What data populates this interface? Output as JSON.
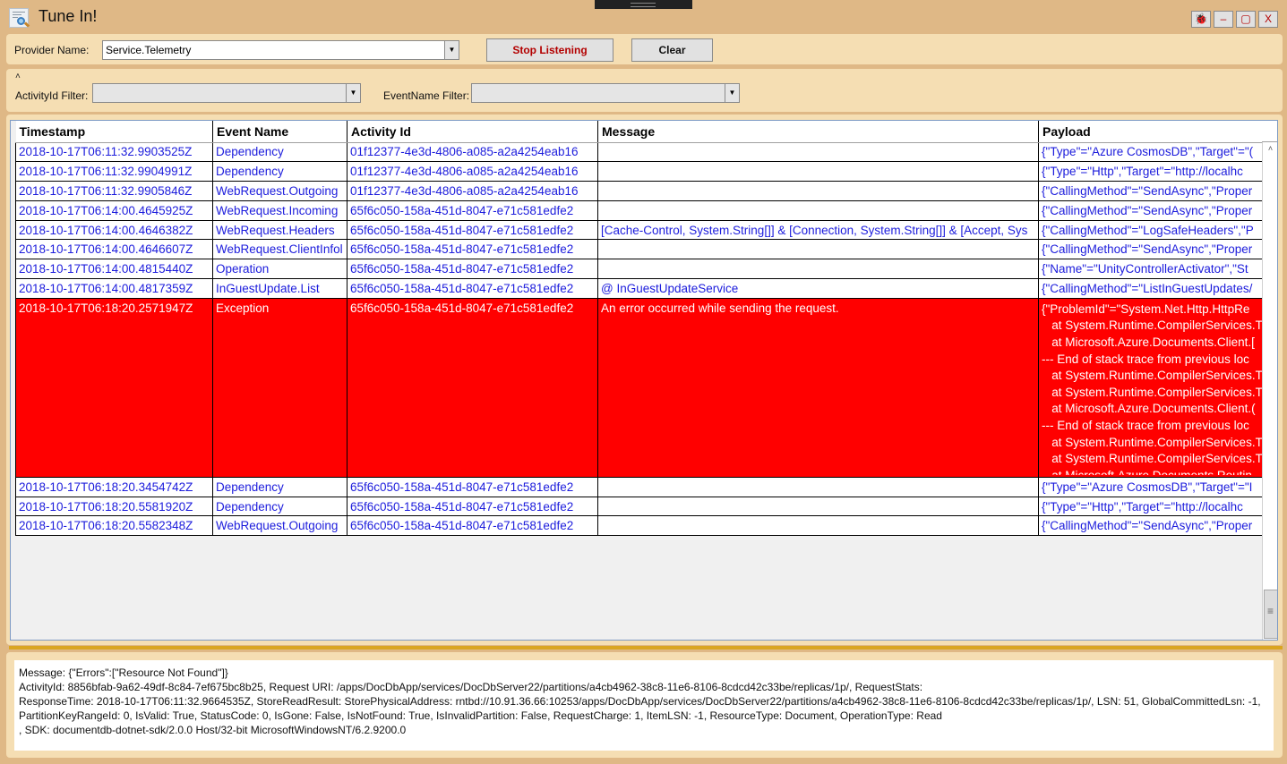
{
  "window": {
    "title": "Tune In!",
    "icon": "log-magnifier-icon",
    "controls": [
      {
        "name": "bug-button",
        "glyph": "🐞",
        "icon": "bug-icon"
      },
      {
        "name": "minimize-button",
        "glyph": "–",
        "icon": "minimize-icon"
      },
      {
        "name": "maximize-button",
        "glyph": "▢",
        "icon": "maximize-icon"
      },
      {
        "name": "close-button",
        "glyph": "X",
        "icon": "close-icon"
      }
    ]
  },
  "toolbar": {
    "provider_label": "Provider Name:",
    "provider_value": "Service.Telemetry",
    "stop_label": "Stop Listening",
    "clear_label": "Clear"
  },
  "filters": {
    "collapse_glyph": "˄",
    "activity_label": "ActivityId Filter:",
    "activity_value": "",
    "event_label": "EventName Filter:",
    "event_value": ""
  },
  "grid": {
    "columns": [
      "Timestamp",
      "Event Name",
      "Activity Id",
      "Message",
      "Payload"
    ],
    "rows": [
      {
        "timestamp": "2018-10-17T06:11:32.9903525Z",
        "event": "Dependency",
        "activity": "01f12377-4e3d-4806-a085-a2a4254eab16",
        "message": "",
        "payload": "{\"Type\"=\"Azure CosmosDB\",\"Target\"=\"("
      },
      {
        "timestamp": "2018-10-17T06:11:32.9904991Z",
        "event": "Dependency",
        "activity": "01f12377-4e3d-4806-a085-a2a4254eab16",
        "message": "",
        "payload": "{\"Type\"=\"Http\",\"Target\"=\"http://localhc"
      },
      {
        "timestamp": "2018-10-17T06:11:32.9905846Z",
        "event": "WebRequest.Outgoing",
        "activity": "01f12377-4e3d-4806-a085-a2a4254eab16",
        "message": "",
        "payload": "{\"CallingMethod\"=\"SendAsync\",\"Proper"
      },
      {
        "timestamp": "2018-10-17T06:14:00.4645925Z",
        "event": "WebRequest.Incoming",
        "activity": "65f6c050-158a-451d-8047-e71c581edfe2",
        "message": "",
        "payload": "{\"CallingMethod\"=\"SendAsync\",\"Proper"
      },
      {
        "timestamp": "2018-10-17T06:14:00.4646382Z",
        "event": "WebRequest.Headers",
        "activity": "65f6c050-158a-451d-8047-e71c581edfe2",
        "message": "[Cache-Control, System.String[]] & [Connection, System.String[]] & [Accept, Sys",
        "payload": "{\"CallingMethod\"=\"LogSafeHeaders\",\"P"
      },
      {
        "timestamp": "2018-10-17T06:14:00.4646607Z",
        "event": "WebRequest.ClientInfol",
        "activity": "65f6c050-158a-451d-8047-e71c581edfe2",
        "message": "",
        "payload": "{\"CallingMethod\"=\"SendAsync\",\"Proper"
      },
      {
        "timestamp": "2018-10-17T06:14:00.4815440Z",
        "event": "Operation",
        "activity": "65f6c050-158a-451d-8047-e71c581edfe2",
        "message": "",
        "payload": "{\"Name\"=\"UnityControllerActivator\",\"St"
      },
      {
        "timestamp": "2018-10-17T06:14:00.4817359Z",
        "event": "InGuestUpdate.List",
        "activity": "65f6c050-158a-451d-8047-e71c581edfe2",
        "message": "@ InGuestUpdateService",
        "payload": "{\"CallingMethod\"=\"ListInGuestUpdates/"
      }
    ],
    "error_row": {
      "timestamp": "2018-10-17T06:18:20.2571947Z",
      "event": "Exception",
      "activity": "65f6c050-158a-451d-8047-e71c581edfe2",
      "message": "An error occurred while sending the request.",
      "payload_lines": [
        "{\"ProblemId\"=\"System.Net.Http.HttpRe",
        "   at System.Runtime.CompilerServices.T",
        "   at Microsoft.Azure.Documents.Client.[",
        "--- End of stack trace from previous loc",
        "   at System.Runtime.CompilerServices.T",
        "   at System.Runtime.CompilerServices.T",
        "   at Microsoft.Azure.Documents.Client.(",
        "--- End of stack trace from previous loc",
        "   at System.Runtime.CompilerServices.T",
        "   at System.Runtime.CompilerServices.T",
        "   at Microsoft.Azure.Documents.Routin"
      ],
      "highlight_color": "#ff0000"
    },
    "rows_after": [
      {
        "timestamp": "2018-10-17T06:18:20.3454742Z",
        "event": "Dependency",
        "activity": "65f6c050-158a-451d-8047-e71c581edfe2",
        "message": "",
        "payload": "{\"Type\"=\"Azure CosmosDB\",\"Target\"=\"I"
      },
      {
        "timestamp": "2018-10-17T06:18:20.5581920Z",
        "event": "Dependency",
        "activity": "65f6c050-158a-451d-8047-e71c581edfe2",
        "message": "",
        "payload": "{\"Type\"=\"Http\",\"Target\"=\"http://localhc"
      },
      {
        "timestamp": "2018-10-17T06:18:20.5582348Z",
        "event": "WebRequest.Outgoing",
        "activity": "65f6c050-158a-451d-8047-e71c581edfe2",
        "message": "",
        "payload": "{\"CallingMethod\"=\"SendAsync\",\"Proper"
      }
    ]
  },
  "detail": {
    "lines": [
      "Message: {\"Errors\":[\"Resource Not Found\"]}",
      "ActivityId: 8856bfab-9a62-49df-8c84-7ef675bc8b25, Request URI: /apps/DocDbApp/services/DocDbServer22/partitions/a4cb4962-38c8-11e6-8106-8cdcd42c33be/replicas/1p/, RequestStats:",
      "ResponseTime: 2018-10-17T06:11:32.9664535Z, StoreReadResult: StorePhysicalAddress: rntbd://10.91.36.66:10253/apps/DocDbApp/services/DocDbServer22/partitions/a4cb4962-38c8-11e6-8106-8cdcd42c33be/replicas/1p/, LSN: 51, GlobalCommittedLsn: -1,",
      "PartitionKeyRangeId: 0, IsValid: True, StatusCode: 0, IsGone: False, IsNotFound: True, IsInvalidPartition: False, RequestCharge: 1, ItemLSN: -1, ResourceType: Document, OperationType: Read",
      ", SDK: documentdb-dotnet-sdk/2.0.0 Host/32-bit MicrosoftWindowsNT/6.2.9200.0"
    ]
  },
  "colors": {
    "window_bg": "#dfb886",
    "panel_bg": "#f5deb3",
    "link_text": "#1c1cdc",
    "error_row": "#ff0000",
    "stop_text": "#b30000",
    "separator": "#daa520"
  }
}
